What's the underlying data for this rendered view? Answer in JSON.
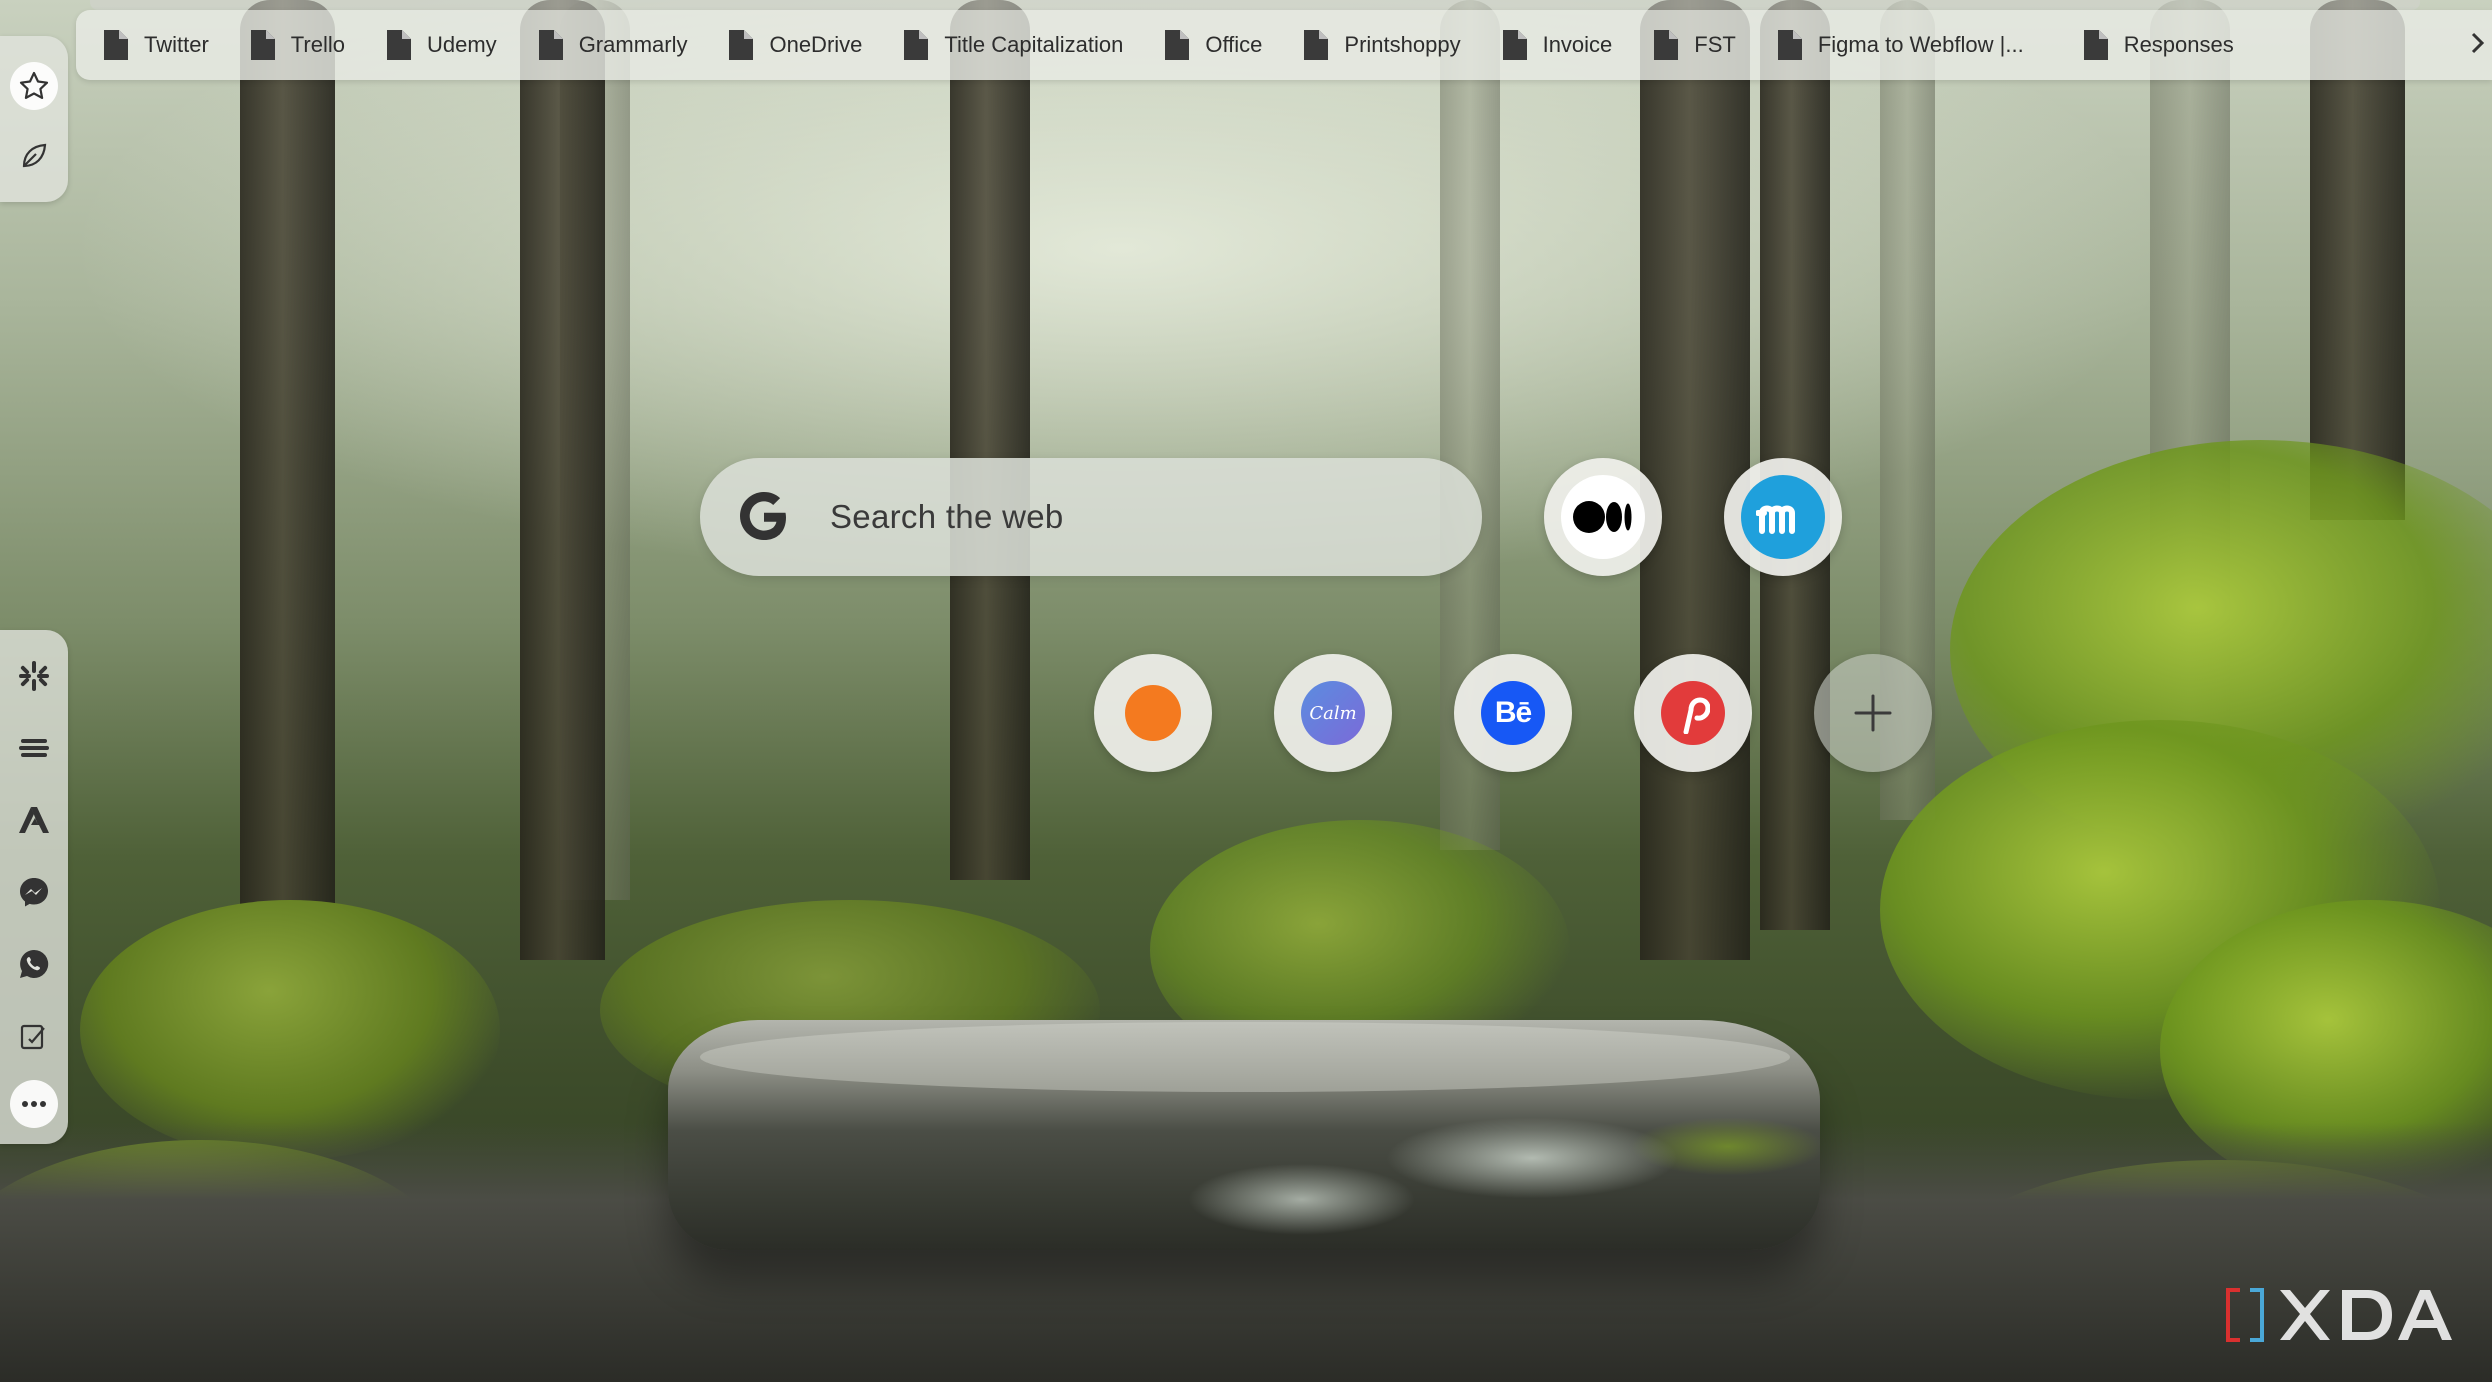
{
  "bookmarks": [
    {
      "label": "Twitter"
    },
    {
      "label": "Trello"
    },
    {
      "label": "Udemy"
    },
    {
      "label": "Grammarly"
    },
    {
      "label": "OneDrive"
    },
    {
      "label": "Title Capitalization"
    },
    {
      "label": "Office"
    },
    {
      "label": "Printshoppy"
    },
    {
      "label": "Invoice"
    },
    {
      "label": "FST"
    },
    {
      "label": "Figma to Webflow |..."
    },
    {
      "label": "Responses"
    }
  ],
  "search": {
    "placeholder": "Search the web",
    "engine_icon": "google-g-icon"
  },
  "shortcuts_row1": [
    {
      "icon": "medium-icon",
      "color": "#000000"
    },
    {
      "icon": "mailerlite-m-icon",
      "color": "#1fa0dc"
    }
  ],
  "shortcuts_row2": [
    {
      "icon": "orange-circle-icon",
      "color": "#f47a1f"
    },
    {
      "icon": "calm-icon",
      "color": "#5b8de0",
      "logo_text": "Calm"
    },
    {
      "icon": "behance-icon",
      "color": "#1758f5",
      "logo_text": "Bē"
    },
    {
      "icon": "pinterest-p-icon",
      "color": "#e23b3b"
    },
    {
      "icon": "plus-icon",
      "color": "#3a3a3a"
    }
  ],
  "sidebar_top": [
    "star-icon",
    "leaf-icon"
  ],
  "sidebar_bottom": [
    "slack-icon",
    "layers-icon",
    "adobe-icon",
    "messenger-icon",
    "whatsapp-icon",
    "notes-icon",
    "more-icon"
  ],
  "watermark": "XDA"
}
